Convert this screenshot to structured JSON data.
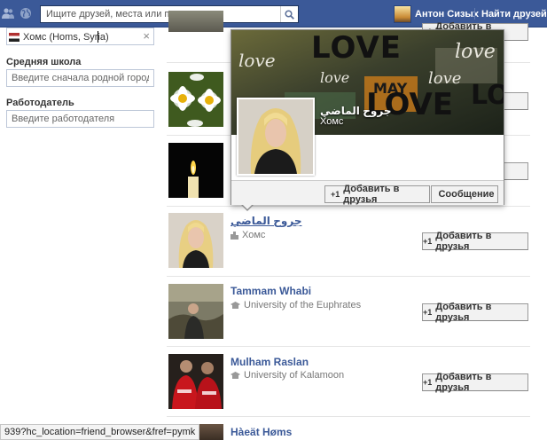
{
  "topbar": {
    "search_placeholder": "Ищите друзей, места или предметы",
    "user_name": "Антон Сизых",
    "find_friends": "Найти друзей",
    "colors": {
      "bar": "#3b5998",
      "link": "#3b5998"
    }
  },
  "filters": {
    "city_token": "Хомс (Homs, Syria)",
    "school_label": "Средняя школа",
    "school_placeholder": "Введите сначала родной город",
    "employer_label": "Работодатель",
    "employer_placeholder": "Введите работодателя"
  },
  "people": [
    {
      "name": "",
      "sub": "",
      "button": "Добавить в друзья"
    },
    {
      "name": "",
      "sub": "",
      "button": "Добавить в друзья"
    },
    {
      "name": "",
      "sub": "",
      "button": "Добавить в друзья"
    },
    {
      "name": "جروح الماضي",
      "sub": "Хомс",
      "sub_icon": "place-icon",
      "button": "Добавить в друзья"
    },
    {
      "name": "Tammam Whabi",
      "sub": "University of the Euphrates",
      "sub_icon": "school-icon",
      "button": "Добавить в друзья"
    },
    {
      "name": "Mulham Raslan",
      "sub": "University of Kalamoon",
      "sub_icon": "school-icon",
      "button": "Добавить в друзья"
    },
    {
      "name": "Hàeät Høms",
      "sub": "",
      "button": ""
    }
  ],
  "hover_card": {
    "cover_words": [
      "LOVE",
      "love",
      "love",
      "MAY",
      "LOVE",
      "LOVE",
      "love",
      "love"
    ],
    "name": "جروح الماضي",
    "sub": "Хомс",
    "add_button": "Добавить в друзья",
    "message_button": "Сообщение"
  },
  "statusbar": {
    "url": "939?hc_location=friend_browser&fref=pymk"
  }
}
